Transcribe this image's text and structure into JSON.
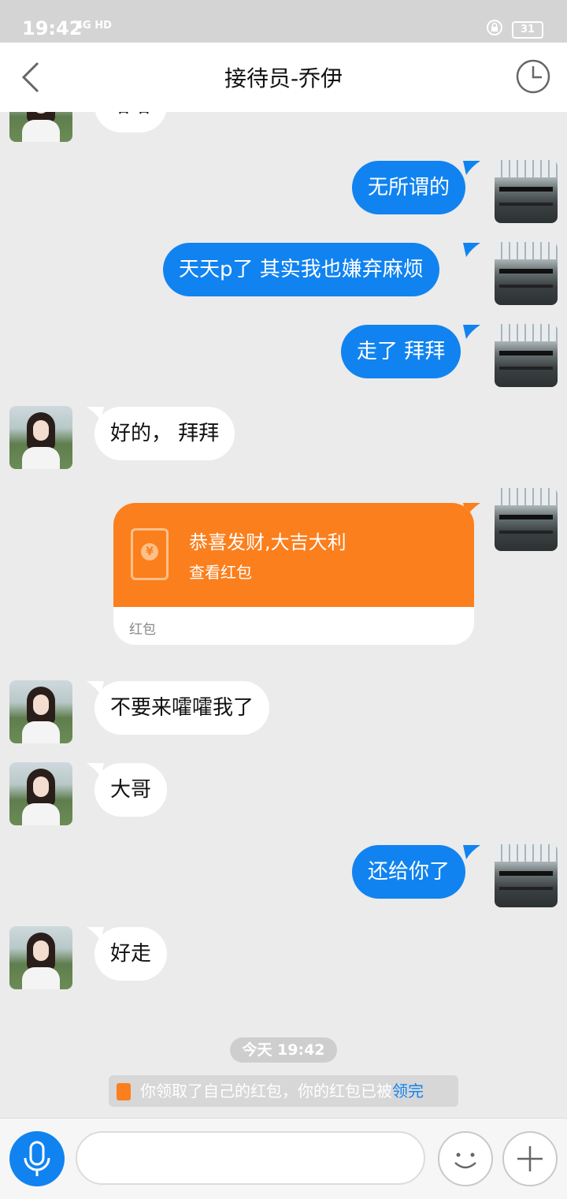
{
  "status_bar": {
    "time": "19:42",
    "network": "4G HD",
    "battery": "31"
  },
  "nav": {
    "title": "接待员-乔伊"
  },
  "messages": [
    {
      "side": "in",
      "text": "哈哈"
    },
    {
      "side": "out",
      "text": "无所谓的"
    },
    {
      "side": "out",
      "text": "天天p了  其实我也嫌弃麻烦"
    },
    {
      "side": "out",
      "text": "走了 拜拜"
    },
    {
      "side": "in",
      "text": "好的， 拜拜"
    },
    {
      "side": "in",
      "text": "不要来嚯嚯我了"
    },
    {
      "side": "in",
      "text": "大哥"
    },
    {
      "side": "out",
      "text": "还给你了"
    },
    {
      "side": "in",
      "text": "好走"
    }
  ],
  "red_packet": {
    "title": "恭喜发财,大吉大利",
    "action": "查看红包",
    "footer": "红包",
    "coin": "¥"
  },
  "time_divider": "今天 19:42",
  "system_message": {
    "text": "你领取了自己的红包，你的红包已被",
    "link": "领完"
  },
  "colors": {
    "accent": "#1183f0",
    "red_packet": "#fb7f1d",
    "background": "#ebebeb"
  },
  "icons": {
    "back": "chevron-left-icon",
    "history": "clock-icon",
    "mic": "microphone-icon",
    "emoji": "smiley-icon",
    "plus": "plus-icon"
  }
}
